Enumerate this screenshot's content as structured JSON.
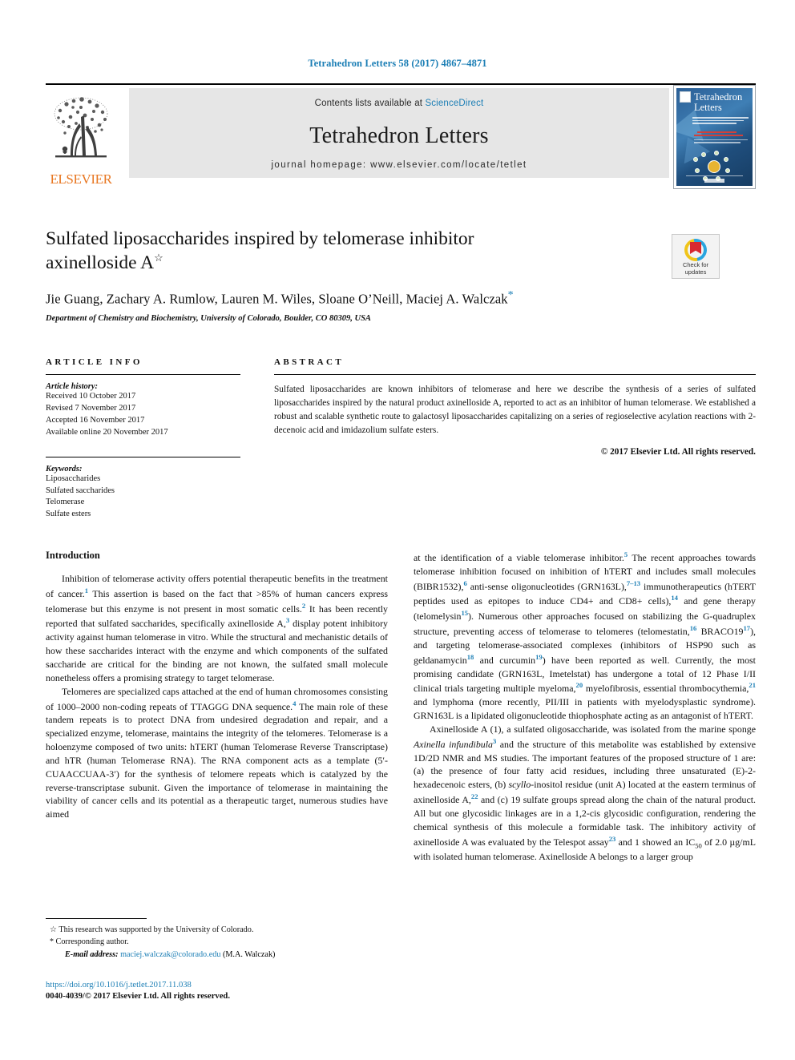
{
  "running_head": "Tetrahedron Letters 58 (2017) 4867–4871",
  "masthead": {
    "contents_prefix": "Contents lists available at ",
    "sciencedirect": "ScienceDirect",
    "journal_title": "Tetrahedron Letters",
    "homepage": "journal homepage: www.elsevier.com/locate/tetlet",
    "publisher": "ELSEVIER",
    "cover_title_line1": "Tetrahedron",
    "cover_title_line2": "Letters"
  },
  "crossmark": {
    "line1": "Check for",
    "line2": "updates"
  },
  "article": {
    "title_line1": "Sulfated liposaccharides inspired by telomerase inhibitor",
    "title_line2": "axinelloside A",
    "title_marker": "☆",
    "authors": "Jie Guang, Zachary A. Rumlow, Lauren M. Wiles, Sloane O’Neill, Maciej A. Walczak",
    "corresponding_marker": "*",
    "affiliation": "Department of Chemistry and Biochemistry, University of Colorado, Boulder, CO 80309, USA"
  },
  "info": {
    "heading": "ARTICLE INFO",
    "history_label": "Article history:",
    "history": [
      "Received 10 October 2017",
      "Revised 7 November 2017",
      "Accepted 16 November 2017",
      "Available online 20 November 2017"
    ],
    "keywords_label": "Keywords:",
    "keywords": [
      "Liposaccharides",
      "Sulfated saccharides",
      "Telomerase",
      "Sulfate esters"
    ]
  },
  "abstract": {
    "heading": "ABSTRACT",
    "text": "Sulfated liposaccharides are known inhibitors of telomerase and here we describe the synthesis of a series of sulfated liposaccharides inspired by the natural product axinelloside A, reported to act as an inhibitor of human telomerase. We established a robust and scalable synthetic route to galactosyl liposaccharides capitalizing on a series of regioselective acylation reactions with 2-decenoic acid and imidazolium sulfate esters.",
    "copyright": "© 2017 Elsevier Ltd. All rights reserved."
  },
  "body": {
    "section_heading": "Introduction",
    "left_para_1_a": "Inhibition of telomerase activity offers potential therapeutic benefits in the treatment of cancer.",
    "left_para_1_b": " This assertion is based on the fact that >85% of human cancers express telomerase but this enzyme is not present in most somatic cells.",
    "left_para_1_c": " It has been recently reported that sulfated saccharides, specifically axinelloside A,",
    "left_para_1_d": " display potent inhibitory activity against human telomerase in vitro. While the structural and mechanistic details of how these saccharides interact with the enzyme and which components of the sulfated saccharide are critical for the binding are not known, the sulfated small molecule nonetheless offers a promising strategy to target telomerase.",
    "left_para_2_a": "Telomeres are specialized caps attached at the end of human chromosomes consisting of 1000–2000 non-coding repeats of TTAGGG DNA sequence.",
    "left_para_2_b": " The main role of these tandem repeats is to protect DNA from undesired degradation and repair, and a specialized enzyme, telomerase, maintains the integrity of the telomeres. Telomerase is a holoenzyme composed of two units: hTERT (human Telomerase Reverse Transcriptase) and hTR (human Telomerase RNA). The RNA component acts as a template (5′-CUAACCUAA-3′) for the synthesis of telomere repeats which is catalyzed by the reverse-transcriptase subunit. Given the importance of telomerase in maintaining the viability of cancer cells and its potential as a therapeutic target, numerous studies have aimed",
    "right_para_1_a": "at the identification of a viable telomerase inhibitor.",
    "right_para_1_b": " The recent approaches towards telomerase inhibition focused on inhibition of hTERT and includes small molecules (BIBR1532),",
    "right_para_1_c": " anti-sense oligonucleotides (GRN163L),",
    "right_para_1_d": " immunotherapeutics (hTERT peptides used as epitopes to induce CD4+ and CD8+ cells),",
    "right_para_1_e": " and gene therapy (telomelysin",
    "right_para_1_f": "). Numerous other approaches focused on stabilizing the G-quadruplex structure, preventing access of telomerase to telomeres (telomestatin,",
    "right_para_1_g": " BRACO19",
    "right_para_1_h": "), and targeting telomerase-associated complexes (inhibitors of HSP90 such as geldanamycin",
    "right_para_1_i": " and curcumin",
    "right_para_1_j": ") have been reported as well. Currently, the most promising candidate (GRN163L, Imetelstat) has undergone a total of 12 Phase I/II clinical trials targeting multiple myeloma,",
    "right_para_1_k": " myelofibrosis, essential thrombocythemia,",
    "right_para_1_l": " and lymphoma (more recently, PII/III in patients with myelodysplastic syndrome). GRN163L is a lipidated oligonucleotide thiophosphate acting as an antagonist of hTERT.",
    "right_para_2_a": "Axinelloside A (1), a sulfated oligosaccharide, was isolated from the marine sponge ",
    "right_para_2_sponge": "Axinella infundibula",
    "right_para_2_b": " and the structure of this metabolite was established by extensive 1D/2D NMR and MS studies. The important features of the proposed structure of 1 are: (a) the presence of four fatty acid residues, including three unsaturated (E)-2-hexadecenoic esters, (b) ",
    "right_para_2_scyllo": "scyllo",
    "right_para_2_c": "-inositol residue (unit A) located at the eastern terminus of axinelloside A,",
    "right_para_2_d": " and (c) 19 sulfate groups spread along the chain of the natural product. All but one glycosidic linkages are in a 1,2-cis glycosidic configuration, rendering the chemical synthesis of this molecule a formidable task. The inhibitory activity of axinelloside A was evaluated by the Telespot assay",
    "right_para_2_e": " and 1 showed an IC",
    "right_para_2_f": "50",
    "right_para_2_g": " of 2.0 µg/mL with isolated human telomerase. Axinelloside A belongs to a larger group",
    "refs": {
      "r1": "1",
      "r2": "2",
      "r3": "3",
      "r4": "4",
      "r5": "5",
      "r6": "6",
      "r7_13": "7–13",
      "r14": "14",
      "r15": "15",
      "r16": "16",
      "r17": "17",
      "r18": "18",
      "r19": "19",
      "r20": "20",
      "r21": "21",
      "r22": "22",
      "r23": "23"
    }
  },
  "footnotes": {
    "star_symbol": "☆",
    "star_text": "This research was supported by the University of Colorado.",
    "corr_symbol": "*",
    "corr_text": "Corresponding author.",
    "email_label": "E-mail address:",
    "email": "maciej.walczak@colorado.edu",
    "email_suffix": "(M.A. Walczak)",
    "doi": "https://doi.org/10.1016/j.tetlet.2017.11.038",
    "issn_line": "0040-4039/© 2017 Elsevier Ltd. All rights reserved."
  },
  "colors": {
    "accent_blue": "#1b7eb5",
    "elsevier_orange": "#e87722",
    "band_gray": "#e6e6e6"
  }
}
